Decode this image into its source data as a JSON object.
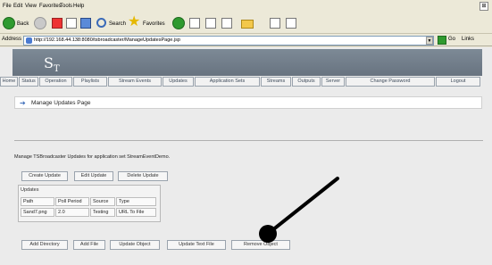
{
  "menu": {
    "items": [
      "File",
      "Edit",
      "View",
      "Favorites",
      "Tools",
      "Help"
    ]
  },
  "toolbar": {
    "back_label": "Back",
    "search_label": "Search",
    "favorites_label": "Favorites"
  },
  "address": {
    "label": "Address",
    "url": "http://192.168.44.138:8080/tsbroadcaster/ManageUpdatesPage.jsp",
    "go_label": "Go",
    "links_label": "Links"
  },
  "logo": {
    "main": "S",
    "sub": "T"
  },
  "nav": {
    "items": [
      "Home",
      "Status",
      "Operation",
      "Playlists",
      "Stream Events",
      "Updates",
      "Application Sets",
      "Streams",
      "Outputs",
      "Server",
      "Change Password",
      "Logout"
    ]
  },
  "page": {
    "title": "Manage Updates Page",
    "manage_text": "Manage TSBroadcaster Updates for application set StreamEventDemo.",
    "top_buttons": [
      "Create Update",
      "Edit Update",
      "Delete Update"
    ],
    "updates": {
      "title": "Updates",
      "headers": [
        "Path",
        "Poll Period",
        "Source",
        "Type"
      ],
      "rows": [
        [
          "Sand7.png",
          "2.0",
          "Testing",
          "URL To File"
        ]
      ]
    },
    "bottom_buttons": [
      "Add Directory",
      "Add File",
      "Update Object",
      "Update Text File",
      "Remove Object"
    ]
  },
  "colors": {
    "banner": "#7d8a96",
    "nav_text": "#3d4a5a",
    "page_bg": "#ebebeb",
    "annotation_arrow": "#000000"
  }
}
